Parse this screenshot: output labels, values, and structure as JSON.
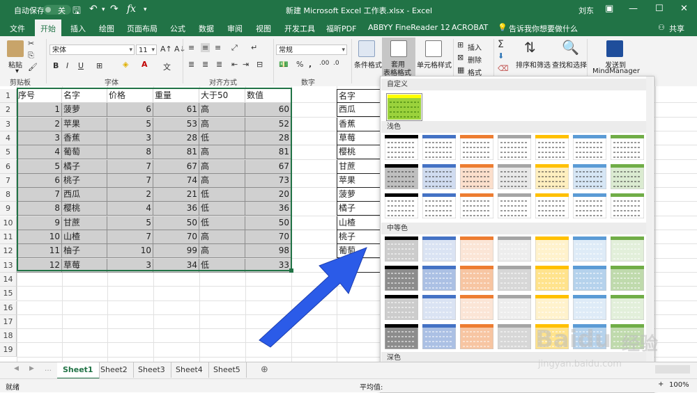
{
  "titlebar": {
    "autosave_label": "自动保存",
    "toggle_state": "关",
    "window_title": "新建 Microsoft Excel 工作表.xlsx  -  Excel",
    "user_name": "刘东",
    "accent_color": "#217346"
  },
  "tabs": [
    "文件",
    "开始",
    "插入",
    "绘图",
    "页面布局",
    "公式",
    "数据",
    "审阅",
    "视图",
    "开发工具",
    "福昕PDF",
    "ABBYY FineReader 12",
    "ACROBAT"
  ],
  "active_tab": "开始",
  "tell_me": "告诉我你想要做什么",
  "share": "共享",
  "ribbon": {
    "paste": "粘贴",
    "clipboard": "剪贴板",
    "font_name": "宋体",
    "font_size": "11",
    "font_group": "字体",
    "align_group": "对齐方式",
    "number_format": "常规",
    "number_group": "数字",
    "cond_format": "条件格式",
    "table_format_1": "套用",
    "table_format_2": "表格格式",
    "cell_style": "单元格样式",
    "insert": "插入",
    "delete": "删除",
    "format": "格式",
    "sort_filter": "排序和筛选",
    "find_select": "查找和选择",
    "send_to_1": "发送到",
    "send_to_2": "MindManager"
  },
  "table": {
    "headers": [
      "序号",
      "名字",
      "价格",
      "重量",
      "大于50",
      "数值"
    ],
    "rows": [
      [
        "1",
        "菠萝",
        "6",
        "61",
        "高",
        "60"
      ],
      [
        "2",
        "苹果",
        "5",
        "53",
        "高",
        "52"
      ],
      [
        "3",
        "香蕉",
        "3",
        "28",
        "低",
        "28"
      ],
      [
        "4",
        "葡萄",
        "8",
        "81",
        "高",
        "81"
      ],
      [
        "5",
        "橘子",
        "7",
        "67",
        "高",
        "67"
      ],
      [
        "6",
        "桃子",
        "7",
        "74",
        "高",
        "73"
      ],
      [
        "7",
        "西瓜",
        "2",
        "21",
        "低",
        "20"
      ],
      [
        "8",
        "樱桃",
        "4",
        "36",
        "低",
        "36"
      ],
      [
        "9",
        "甘蔗",
        "5",
        "50",
        "低",
        "50"
      ],
      [
        "10",
        "山楂",
        "7",
        "70",
        "高",
        "70"
      ],
      [
        "11",
        "柚子",
        "10",
        "99",
        "高",
        "98"
      ],
      [
        "12",
        "草莓",
        "3",
        "34",
        "低",
        "33"
      ]
    ]
  },
  "side_list": [
    "名字",
    "西瓜",
    "香蕉",
    "草莓",
    "樱桃",
    "甘蔗",
    "苹果",
    "菠萝",
    "橘子",
    "山楂",
    "桃子",
    "葡萄",
    "柚子"
  ],
  "row_numbers": [
    "1",
    "2",
    "3",
    "4",
    "5",
    "6",
    "7",
    "8",
    "9",
    "10",
    "11",
    "12",
    "13",
    "14",
    "15",
    "16",
    "17",
    "18",
    "19"
  ],
  "gallery": {
    "custom": "自定义",
    "light": "浅色",
    "medium": "中等色",
    "dark": "深色",
    "palette": [
      "#000000",
      "#4472c4",
      "#ed7d31",
      "#a5a5a5",
      "#ffc000",
      "#5b9bd5",
      "#70ad47"
    ],
    "custom_color": "#9bd23c"
  },
  "sheet_tabs": [
    "Sheet1",
    "Sheet2",
    "Sheet3",
    "Sheet4",
    "Sheet5"
  ],
  "active_sheet": "Sheet1",
  "status": {
    "mode": "就绪",
    "average": "平均值:",
    "zoom": "100%"
  },
  "watermark": {
    "brand": "Baidu",
    "cn": "经验",
    "url": "jingyan.baidu.com"
  }
}
